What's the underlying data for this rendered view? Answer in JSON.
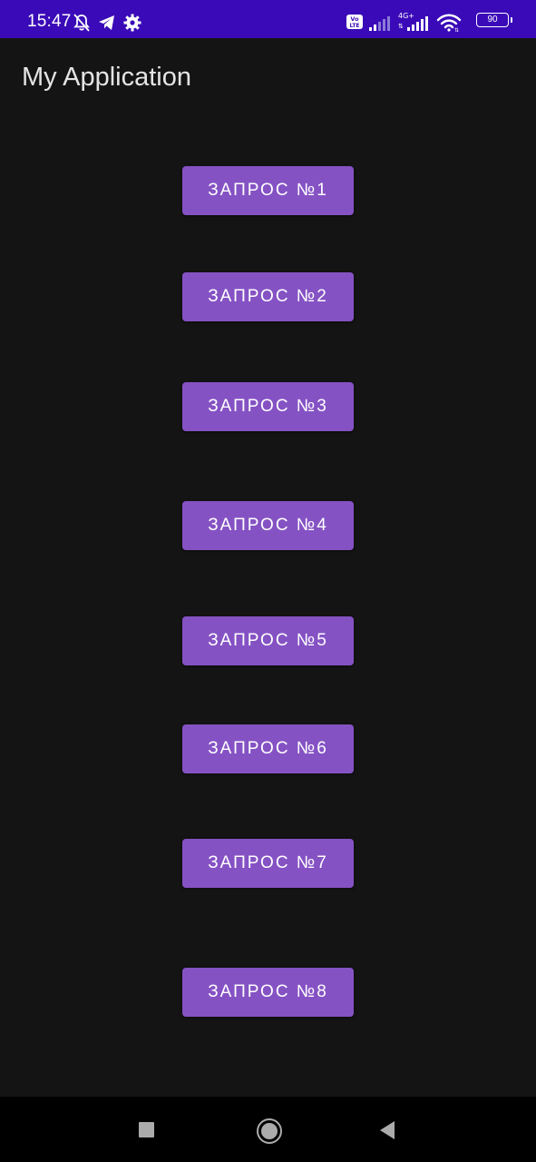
{
  "status_bar": {
    "time": "15:47",
    "left_icons": [
      "bell-off-icon",
      "telegram-icon",
      "settings-gear-icon"
    ],
    "right_icons": [
      "volte-icon",
      "signal-icon",
      "signal-4g-icon",
      "wifi-icon",
      "battery-icon"
    ],
    "network_label": "4G+",
    "volte_label": "Vo LTE",
    "battery_level": "90",
    "background_color": "#3a0ab8"
  },
  "app_bar": {
    "title": "My Application"
  },
  "buttons": [
    {
      "label": "ЗАПРОС №1"
    },
    {
      "label": "ЗАПРОС №2"
    },
    {
      "label": "ЗАПРОС №3"
    },
    {
      "label": "ЗАПРОС №4"
    },
    {
      "label": "ЗАПРОС №5"
    },
    {
      "label": "ЗАПРОС №6"
    },
    {
      "label": "ЗАПРОС №7"
    },
    {
      "label": "ЗАПРОС №8"
    }
  ],
  "button_color": "#8552c4",
  "background_color": "#141414",
  "nav_bar": {
    "icons": [
      "recents-square-icon",
      "home-circle-icon",
      "back-triangle-icon"
    ]
  }
}
